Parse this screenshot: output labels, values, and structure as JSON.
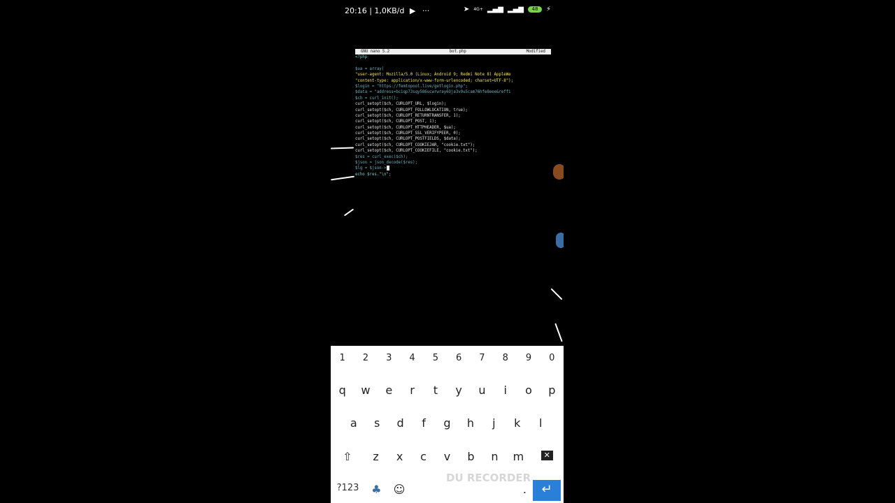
{
  "status_bar": {
    "time_speed": "20:16 | 1,0KB/d",
    "dots": "···",
    "network": "4G+",
    "battery": "48"
  },
  "nano": {
    "version": "GNU nano 5.2",
    "filename": "bot.php",
    "state": "Modified",
    "lines": [
      "<?php",
      "",
      "$ua = array(",
      "\"user-agent: Mozilla/5.0 (Linux; Android 9; Redmi Note 8) AppleWe",
      "\"content-type: application/x-www-form-urlencoded; charset=UTF-8\");",
      "$login = \"https://femtopool.live/getlogin.php\";",
      "$data = \"address=bc1qp73sqy586ucwrwray6Oja3v9u5cam76hfe8eee&reffi",
      "$ch = curl_init();",
      "curl_setopt($ch, CURLOPT_URL, $login);",
      "curl_setopt($ch, CURLOPT_FOLLOWLOCATION, true);",
      "curl_setopt($ch, CURLOPT_RETURNTRANSFER, 1);",
      "curl_setopt($ch, CURLOPT_POST, 1);",
      "curl_setopt($ch, CURLOPT_HTTPHEADER, $ua);",
      "curl_setopt($ch, CURLOPT_SSL_VERIFYPEER, 0);",
      "curl_setopt($ch, CURLOPT_POSTFIELDS, $data);",
      "curl_setopt($ch, CURLOPT_COOKIEJAR, \"cookie.txt\");",
      "curl_setopt($ch, CURLOPT_COOKIEFILE, \"cookie.txt\");",
      "$res = curl_exec($ch);",
      "$json = json_decode($res);",
      "$lg = $json->",
      "echo $res.\"\\n\";"
    ]
  },
  "keyboard": {
    "numbers": [
      "1",
      "2",
      "3",
      "4",
      "5",
      "6",
      "7",
      "8",
      "9",
      "0"
    ],
    "row1": [
      "q",
      "w",
      "e",
      "r",
      "t",
      "y",
      "u",
      "i",
      "o",
      "p"
    ],
    "row2": [
      "a",
      "s",
      "d",
      "f",
      "g",
      "h",
      "j",
      "k",
      "l"
    ],
    "row3": [
      "z",
      "x",
      "c",
      "v",
      "b",
      "n",
      "m"
    ],
    "symbols_label": "?123",
    "period": ".",
    "enter_glyph": "↵"
  },
  "watermark": "DU RECORDER"
}
